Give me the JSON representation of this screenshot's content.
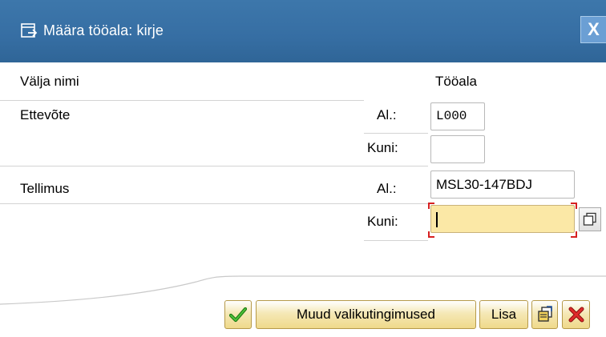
{
  "dialog": {
    "title": "Määra tööala: kirje",
    "close_symbol": "X"
  },
  "headers": {
    "field_name": "Välja nimi",
    "work_area": "Tööala"
  },
  "rows": [
    {
      "field": "Ettevõte",
      "from_label": "Al.:",
      "from_value": "L000",
      "to_label": "Kuni:",
      "to_value": ""
    },
    {
      "field": "Tellimus",
      "from_label": "Al.:",
      "from_value": "MSL30-147BDJ",
      "to_label": "Kuni:",
      "to_value": ""
    }
  ],
  "buttons": {
    "confirm_icon": "checkmark-icon",
    "more_conditions": "Muud valikutingimused",
    "add": "Lisa",
    "multiple_selection_icon": "multiple-selection-icon",
    "cancel_icon": "cancel-icon"
  },
  "colors": {
    "titlebar": "#366ea3",
    "active_field": "#fbe8a6",
    "button_face": "#f5e8b6",
    "required_marker": "#d62020",
    "confirm_green": "#2f9b1f",
    "cancel_red": "#d41f1f"
  }
}
